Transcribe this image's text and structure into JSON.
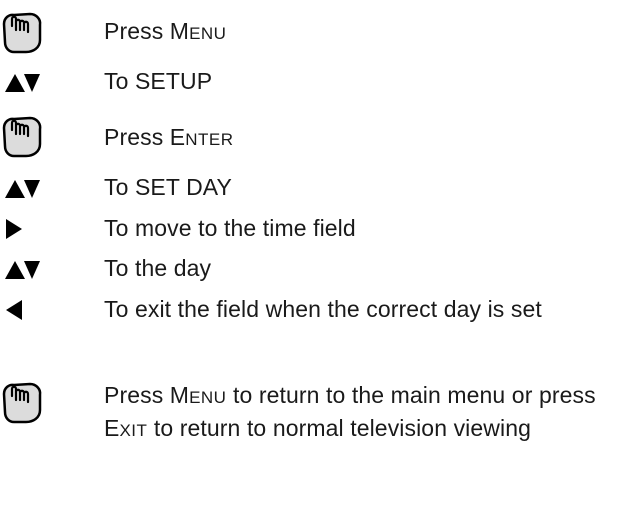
{
  "steps": [
    {
      "icon": "press-hand-icon",
      "text_parts": [
        "Press ",
        "M",
        "ENU",
        "",
        "",
        "",
        "",
        ""
      ]
    },
    {
      "icon": "up-down-arrows-icon",
      "text": "To SETUP"
    },
    {
      "icon": "press-hand-icon",
      "text_parts": [
        "Press ",
        "E",
        "NTER",
        "",
        "",
        "",
        "",
        ""
      ]
    },
    {
      "icon": "up-down-arrows-icon",
      "text": "To SET DAY"
    },
    {
      "icon": "right-arrow-icon",
      "text": "To move to the time field"
    },
    {
      "icon": "up-down-arrows-icon",
      "text": "To the day"
    },
    {
      "icon": "left-arrow-icon",
      "text": "To exit the field when the correct day is set"
    },
    {
      "icon": "press-hand-icon",
      "text_parts": [
        "Press ",
        "M",
        "ENU",
        " to return to the main menu or press ",
        "E",
        "XIT",
        " to return to normal television viewing",
        ""
      ]
    }
  ],
  "colors": {
    "text": "#1a1a1a",
    "icon": "#000000",
    "hand_fill": "#dcdcdc"
  }
}
